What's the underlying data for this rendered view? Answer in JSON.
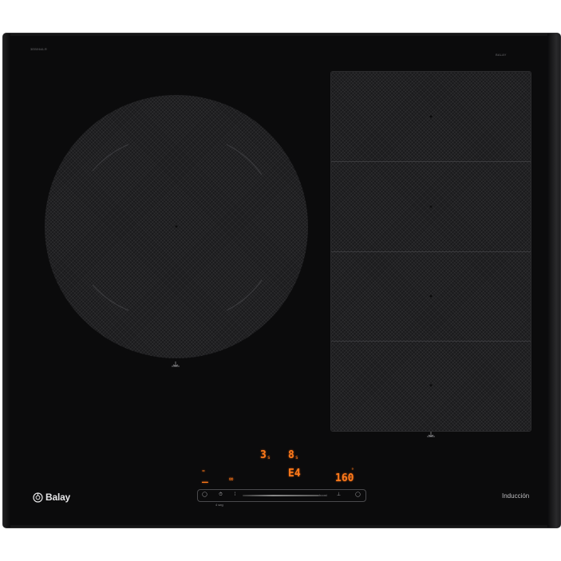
{
  "hob": {
    "model_code": "3EB964LR",
    "serial_tag": "BALAY",
    "brand": "Balay",
    "type_label": "Inducción"
  },
  "displays": {
    "left_timer": "3",
    "left_timer_unit": "s",
    "right_timer": "8",
    "right_timer_unit": "s",
    "error_code": "E4",
    "temperature": "160",
    "left_level": "_"
  },
  "control_strip": {
    "left_sub_label": "4 seg",
    "mid_label": "boost",
    "icons": [
      "power-icon",
      "timer-icon",
      "pause-icon",
      "slider",
      "boost-icon",
      "lock-icon",
      "power-icon"
    ]
  },
  "colors": {
    "glass": "#0b0b0c",
    "zone_mesh": "#1a1a1c",
    "display_orange": "#ff7a1a",
    "text_light": "#e6e6e8"
  }
}
